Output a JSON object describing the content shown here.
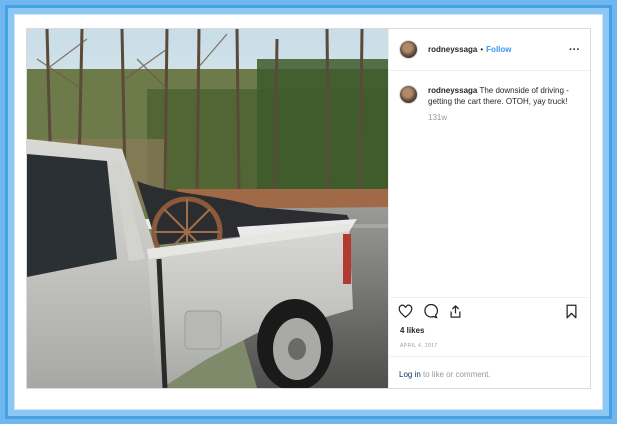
{
  "post": {
    "username": "rodneyssaga",
    "dot": "•",
    "follow_label": "Follow",
    "more_icon": "more-options-icon",
    "caption_user": "rodneyssaga",
    "caption_text": "The downside of driving - getting the cart there. OTOH, yay truck!",
    "age": "131w",
    "likes": "4 likes",
    "date": "APRIL 4, 2017",
    "login_link": "Log in",
    "login_rest": " to like or comment.",
    "icons": [
      "heart-icon",
      "comment-icon",
      "share-icon",
      "bookmark-icon"
    ]
  },
  "colors": {
    "background_frame": "#6fb7f0",
    "follow_link": "#3897f0",
    "login_link": "#003569"
  }
}
